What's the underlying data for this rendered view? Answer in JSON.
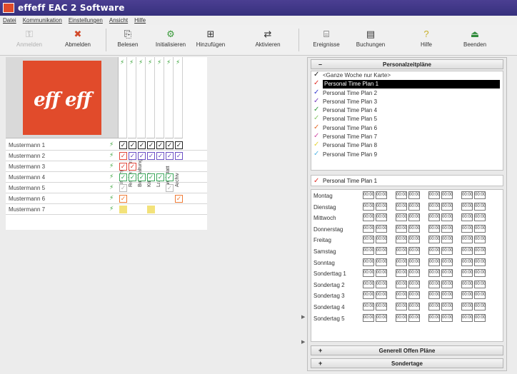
{
  "window": {
    "title": "effeff EAC 2 Software"
  },
  "menu": [
    "Datei",
    "Kommunikation",
    "Einstellungen",
    "Ansicht",
    "Hilfe"
  ],
  "toolbar": [
    {
      "label": "Anmelden",
      "icon": "person-key-icon",
      "glyph": "⚿",
      "disabled": true
    },
    {
      "label": "Abmelden",
      "icon": "person-logout-icon",
      "glyph": "✖"
    },
    {
      "label": "Belesen",
      "icon": "read-card-icon",
      "glyph": "⎘"
    },
    {
      "label": "Initialisieren",
      "icon": "initialize-icon",
      "glyph": "⚙"
    },
    {
      "label": "Hinzufügen",
      "icon": "add-icon",
      "glyph": "⊞"
    },
    {
      "label": "Aktivieren",
      "icon": "activate-icon",
      "glyph": "⇄"
    },
    {
      "label": "Ereignisse",
      "icon": "events-icon",
      "glyph": "⌸"
    },
    {
      "label": "Buchungen",
      "icon": "bookings-icon",
      "glyph": "▤"
    },
    {
      "label": "Hilfe",
      "icon": "help-icon",
      "glyph": "?"
    },
    {
      "label": "Beenden",
      "icon": "exit-icon",
      "glyph": "⏏"
    }
  ],
  "logo": {
    "text": "eff eff"
  },
  "columns": [
    "Eingang 1",
    "Rechenzentrum",
    "Buchhaltung",
    "Küche",
    "Lager",
    "Werkstatt",
    "Archiv"
  ],
  "people": [
    {
      "name": "Mustermann 1",
      "cells": [
        "k",
        "k",
        "k",
        "k",
        "k",
        "k",
        "k"
      ]
    },
    {
      "name": "Mustermann 2",
      "cells": [
        "r",
        "p",
        "p",
        "p",
        "p",
        "p",
        "p"
      ]
    },
    {
      "name": "Mustermann 3",
      "cells": [
        "r",
        "r",
        "",
        "",
        "",
        "",
        ""
      ]
    },
    {
      "name": "Mustermann 4",
      "cells": [
        "g",
        "g",
        "g",
        "g",
        "g",
        "g",
        ""
      ]
    },
    {
      "name": "Mustermann 5",
      "cells": [
        "y",
        "",
        "",
        "",
        "",
        "y",
        ""
      ]
    },
    {
      "name": "Mustermann 6",
      "cells": [
        "o",
        "",
        "",
        "",
        "",
        "",
        "o"
      ]
    },
    {
      "name": "Mustermann 7",
      "cells": [
        "ly",
        "",
        "",
        "ly",
        "",
        "",
        ""
      ]
    }
  ],
  "cell_colors": {
    "k": "#222222",
    "r": "#e0463a",
    "p": "#6a4fc4",
    "g": "#3aa65a",
    "y": "#b8b8b8",
    "o": "#ef7b35",
    "ly": "#f3e27a"
  },
  "personal_plans": {
    "header": "Personalzeitpläne",
    "toggle": "–",
    "items": [
      {
        "label": "<Ganze Woche nur Karte>",
        "color": "#222222"
      },
      {
        "label": "Personal Time Plan 1",
        "color": "#e0312a",
        "selected": true
      },
      {
        "label": "Personal Time Plan 2",
        "color": "#3a3fd0"
      },
      {
        "label": "Personal Time Plan 3",
        "color": "#7a3fc0"
      },
      {
        "label": "Personal Time Plan 4",
        "color": "#2f9a3a"
      },
      {
        "label": "Personal Time Plan 5",
        "color": "#8ac86a"
      },
      {
        "label": "Personal Time Plan 6",
        "color": "#e66b2a"
      },
      {
        "label": "Personal Time Plan 7",
        "color": "#d04fa6"
      },
      {
        "label": "Personal Time Plan 8",
        "color": "#e6d43a"
      },
      {
        "label": "Personal Time Plan 9",
        "color": "#5ab8e6"
      }
    ],
    "selected_label": "Personal Time Plan 1"
  },
  "schedule": {
    "days": [
      "Montag",
      "Dienstag",
      "Mittwoch",
      "Donnerstag",
      "Freitag",
      "Samstag",
      "Sonntag",
      "Sonderttag 1",
      "Sondertag 2",
      "Sondertag 3",
      "Sondertag 4",
      "Sondertag 5"
    ],
    "time": "00:00"
  },
  "sections": {
    "general": {
      "toggle": "+",
      "label": "Generell Offen Pläne"
    },
    "special": {
      "toggle": "+",
      "label": "Sondertage"
    }
  }
}
